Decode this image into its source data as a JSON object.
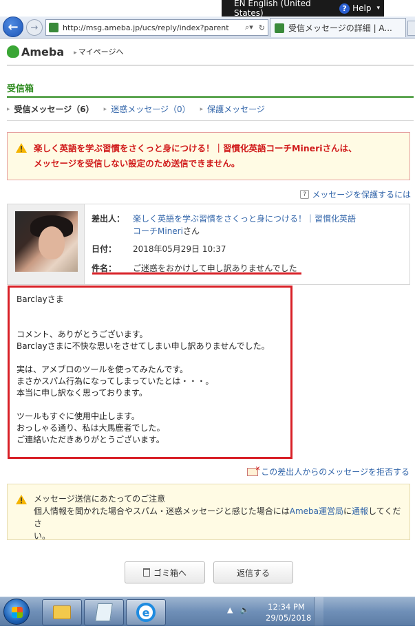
{
  "langbar": {
    "language": "EN English (United States)",
    "help": "Help"
  },
  "browser": {
    "url": "http://msg.ameba.jp/ucs/reply/index?parent",
    "tab_title": "受信メッセージの詳細 | A..."
  },
  "header": {
    "logo": "Ameba",
    "mypage": "マイページへ"
  },
  "inbox": {
    "title": "受信箱",
    "tabs": [
      {
        "label": "受信メッセージ（6）"
      },
      {
        "label": "迷惑メッセージ（0）"
      },
      {
        "label": "保護メッセージ"
      }
    ]
  },
  "error": {
    "line1": "楽しく英語を学ぶ習慣をさくっと身につける！｜習慣化英語コーチMineriさんは、",
    "line2": "メッセージを受信しない設定のため送信できません。"
  },
  "protect_link": "メッセージを保護するには",
  "message": {
    "sender_label": "差出人：",
    "sender_name_line1": "楽しく英語を学ぶ習慣をさくっと身につける！｜習慣化英語",
    "sender_name_line2": "コーチMineri",
    "sender_suffix": "さん",
    "date_label": "日付：",
    "date_value": "2018年05月29日 10:37",
    "subject_label": "件名：",
    "subject_value": "ご迷惑をおかけして申し訳ありませんでした",
    "body": {
      "greeting": "Barclayさま",
      "p1_l1": "コメント、ありがとうございます。",
      "p1_l2": "Barclayさまに不快な思いをさせてしまい申し訳ありませんでした。",
      "p2_l1": "実は、アメブロのツールを使ってみたんです。",
      "p2_l2": "まさかスパム行為になってしまっていたとは・・・。",
      "p2_l3": "本当に申し訳なく思っております。",
      "p3_l1": "ツールもすぐに使用中止します。",
      "p3_l2": "おっしゃる通り、私は大馬鹿者でした。",
      "p3_l3": "ご連絡いただきありがとうございます。"
    }
  },
  "reject_link": "この差出人からのメッセージを拒否する",
  "notice": {
    "title": "メッセージ送信にあたってのご注意",
    "body_pre": "個人情報を聞かれた場合やスパム・迷惑メッセージと感じた場合には",
    "body_link1": "Ameba運営局",
    "body_mid": "に",
    "body_link2": "通報",
    "body_post": "してくださ",
    "body_line2": "い。"
  },
  "buttons": {
    "trash": "ゴミ箱へ",
    "reply": "返信する"
  },
  "taskbar": {
    "time": "12:34 PM",
    "date": "29/05/2018"
  },
  "colors": {
    "green": "#2e8b1f",
    "link": "#3366aa",
    "error_red": "#d01a1a",
    "highlight_red": "#d81f26"
  }
}
